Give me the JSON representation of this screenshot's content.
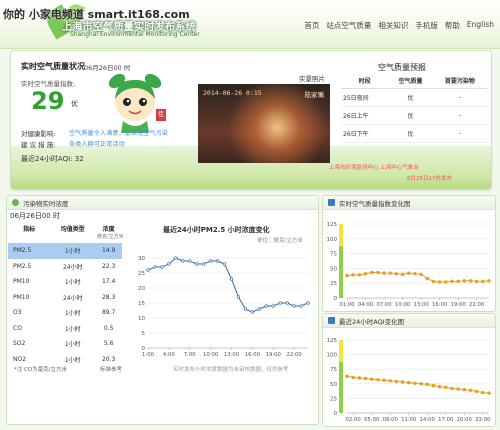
{
  "watermark": "你的 小家电频道 smart.it168.com",
  "header": {
    "title": "上海市空气质量实时发布系统",
    "subtitle": "Shanghai Environmental Monitoring Center",
    "nav": [
      "首页",
      "站点空气质量",
      "相关知识",
      "手机版",
      "帮助",
      "English"
    ]
  },
  "realtime": {
    "title": "实时空气质量状况",
    "date": "06月26日00 时",
    "aqi_label": "实时空气质量指数:",
    "aqi_value": "29",
    "aqi_level": "优",
    "health_label": "对健康影响:",
    "health_value": "空气质量令人满意，基本无空气污染",
    "advice_label": "建 议 措 施:",
    "advice_value": "各类人群可正常活动",
    "aqi24_label": "最近24小时AQI:",
    "aqi24_value": "32",
    "mascot_stamp": "佳"
  },
  "photo": {
    "label": "实景照片",
    "timestamp": "2014-06-26 0:15",
    "site": "陆家嘴"
  },
  "forecast": {
    "title": "空气质量预报",
    "headers": [
      "时段",
      "空气质量",
      "首要污染物"
    ],
    "rows": [
      [
        "25日夜间",
        "优",
        "-"
      ],
      [
        "26日上午",
        "优",
        "-"
      ],
      [
        "26日下午",
        "优",
        "-"
      ]
    ],
    "note": "上海市环境监测中心 上海中心气象台",
    "update": "6月25日17时发布"
  },
  "pollutants": {
    "panel_title": "污染物实时浓度",
    "date": "06月26日00 时",
    "headers": [
      "指标",
      "均值类型",
      "浓度"
    ],
    "unit": "微克/立方米",
    "rows": [
      {
        "name": "PM2.5",
        "type": "1小时",
        "value": "14.9",
        "highlight": true
      },
      {
        "name": "PM2.5",
        "type": "24小时",
        "value": "22.3",
        "highlight": false
      },
      {
        "name": "PM10",
        "type": "1小时",
        "value": "17.4",
        "highlight": false
      },
      {
        "name": "PM10",
        "type": "24小时",
        "value": "28.3",
        "highlight": false
      },
      {
        "name": "O3",
        "type": "1小时",
        "value": "89.7",
        "highlight": false
      },
      {
        "name": "CO",
        "type": "1小时",
        "value": "0.5",
        "highlight": false
      },
      {
        "name": "SO2",
        "type": "1小时",
        "value": "5.6",
        "highlight": false
      },
      {
        "name": "NO2",
        "type": "1小时",
        "value": "20.3",
        "highlight": false
      }
    ],
    "footnote_left": "*注 CO为毫克/立方米",
    "footnote_mid": "标准参考",
    "chart_note": "实时发布小时浓度数据为未审核数据，仅供参考"
  },
  "chart_data": [
    {
      "type": "line",
      "title": "最近24小时PM2.5 小时浓度变化",
      "ylabel": "单位：微克/立方米",
      "x": [
        "1:00",
        "2:00",
        "3:00",
        "4:00",
        "5:00",
        "6:00",
        "7:00",
        "8:00",
        "9:00",
        "10:00",
        "11:00",
        "12:00",
        "13:00",
        "14:00",
        "15:00",
        "16:00",
        "17:00",
        "18:00",
        "19:00",
        "20:00",
        "21:00",
        "22:00",
        "23:00",
        "0:00"
      ],
      "xticks": [
        "1:00",
        "4:00",
        "7:00",
        "10:00",
        "13:00",
        "16:00",
        "19:00",
        "22:00"
      ],
      "yticks": [
        0,
        5,
        10,
        15,
        20,
        25,
        30
      ],
      "ylim": [
        0,
        32
      ],
      "series": [
        {
          "values": [
            26,
            27,
            27,
            28,
            30,
            29,
            29,
            28,
            28,
            29,
            29,
            28,
            23,
            17,
            13,
            12,
            13,
            14,
            14,
            15,
            15,
            14,
            14,
            15
          ]
        }
      ],
      "color": "#2f6ea6"
    },
    {
      "type": "line",
      "title": "实时空气质量指数变化图",
      "x": [
        "01:00",
        "02:00",
        "03:00",
        "04:00",
        "05:00",
        "06:00",
        "07:00",
        "08:00",
        "09:00",
        "10:00",
        "11:00",
        "12:00",
        "13:00",
        "14:00",
        "15:00",
        "16:00",
        "17:00",
        "18:00",
        "19:00",
        "20:00",
        "21:00",
        "22:00",
        "23:00",
        "00:00"
      ],
      "xticks": [
        "01:00",
        "04:00",
        "07:00",
        "10:00",
        "13:00",
        "16:00",
        "19:00",
        "22:00"
      ],
      "yticks": [
        0,
        25,
        50,
        75,
        100,
        125
      ],
      "ylim": [
        0,
        125
      ],
      "series": [
        {
          "values": [
            38,
            39,
            39,
            41,
            43,
            43,
            42,
            42,
            41,
            40,
            42,
            41,
            40,
            33,
            28,
            27,
            27,
            28,
            28,
            29,
            29,
            28,
            28,
            29
          ]
        }
      ],
      "color": "#e6a21f"
    },
    {
      "type": "line",
      "title": "最近24小时AQI变化图",
      "x": [
        "01:00",
        "02:00",
        "03:00",
        "04:00",
        "05:00",
        "06:00",
        "07:00",
        "08:00",
        "09:00",
        "10:00",
        "11:00",
        "12:00",
        "13:00",
        "14:00",
        "15:00",
        "16:00",
        "17:00",
        "18:00",
        "19:00",
        "20:00",
        "21:00",
        "22:00",
        "23:00",
        "00:00"
      ],
      "xticks": [
        "02:00",
        "05:00",
        "08:00",
        "11:00",
        "14:00",
        "17:00",
        "20:00",
        "23:00"
      ],
      "yticks": [
        0,
        25,
        50,
        75,
        100,
        125
      ],
      "ylim": [
        0,
        125
      ],
      "series": [
        {
          "values": [
            63,
            61,
            60,
            59,
            58,
            57,
            56,
            55,
            54,
            53,
            52,
            51,
            50,
            49,
            47,
            45,
            44,
            42,
            41,
            40,
            39,
            37,
            35,
            34
          ]
        }
      ],
      "color": "#e6a21f"
    }
  ],
  "colors": {
    "accent": "#6ab24f",
    "aqi_good": "#2fa12f",
    "highlight": "#a9cdf2",
    "forecast_note": "#ff4d4d"
  }
}
